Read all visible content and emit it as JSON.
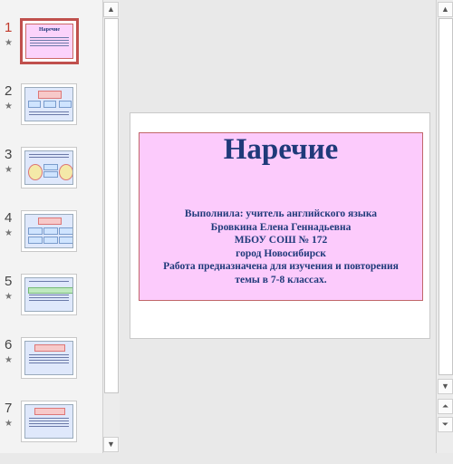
{
  "thumbnails": [
    {
      "number": "1",
      "active": true
    },
    {
      "number": "2",
      "active": false
    },
    {
      "number": "3",
      "active": false
    },
    {
      "number": "4",
      "active": false
    },
    {
      "number": "5",
      "active": false
    },
    {
      "number": "6",
      "active": false
    },
    {
      "number": "7",
      "active": false
    }
  ],
  "star_glyph": "★",
  "slide": {
    "title": "Наречие",
    "lines": [
      "Выполнила: учитель  английского  языка",
      "Бровкина  Елена  Геннадьевна",
      "МБОУ  СОШ № 172",
      "город  Новосибирск",
      "Работа  предназначена  для  изучения  и  повторения",
      "темы  в  7-8 классах."
    ]
  },
  "colors": {
    "slide_panel": "#fccbfc",
    "slide_text": "#1f3a7a",
    "active_thumbnail_border": "#c0504d"
  }
}
